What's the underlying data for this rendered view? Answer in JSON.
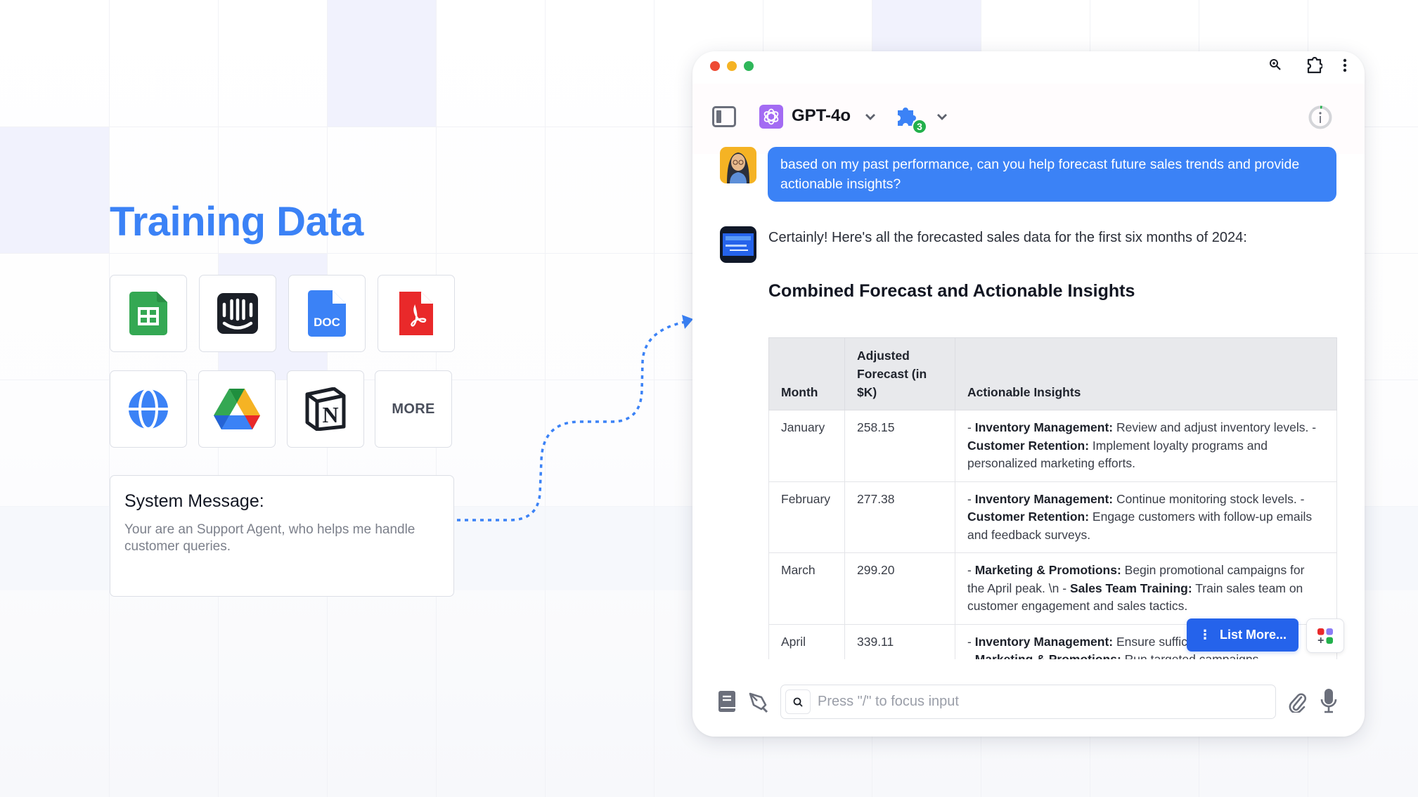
{
  "left": {
    "title": "Training Data",
    "sources": [
      {
        "name": "google-sheets",
        "label": "Google Sheets"
      },
      {
        "name": "intercom",
        "label": "Intercom"
      },
      {
        "name": "doc",
        "label": "DOC"
      },
      {
        "name": "pdf",
        "label": "PDF"
      },
      {
        "name": "website",
        "label": "Website"
      },
      {
        "name": "google-drive",
        "label": "Google Drive"
      },
      {
        "name": "notion",
        "label": "Notion"
      },
      {
        "name": "more",
        "label": "MORE"
      }
    ],
    "doc_badge": "DOC",
    "more_label": "MORE",
    "system_message": {
      "title": "System Message:",
      "text": "Your are an Support Agent, who helps me handle customer queries."
    }
  },
  "window": {
    "traffic_lights": {
      "close": "#ee4b34",
      "minimize": "#f5b324",
      "maximize": "#2fb75a"
    },
    "toolbar_icons": [
      "zoom-icon",
      "extension-icon",
      "more-vertical-icon"
    ],
    "header": {
      "model_name": "GPT-4o",
      "plugin_count": "3"
    },
    "messages": {
      "user": "based on my past performance, can you help forecast future sales trends and provide actionable insights?",
      "assistant_intro": "Certainly! Here's all the forecasted sales data for the first six months of 2024:",
      "heading": "Combined Forecast and Actionable Insights"
    },
    "table": {
      "headers": [
        "Month",
        "Adjusted Forecast (in $K)",
        "Actionable Insights"
      ],
      "rows": [
        {
          "month": "January",
          "forecast": "258.15",
          "insights": [
            {
              "b": "Inventory Management:",
              "t": " Review and adjust inventory levels. -"
            },
            {
              "b": "Customer Retention:",
              "t": " Implement loyalty programs and personalized marketing efforts."
            }
          ]
        },
        {
          "month": "February",
          "forecast": "277.38",
          "insights": [
            {
              "b": "Inventory Management:",
              "t": " Continue monitoring stock levels. -"
            },
            {
              "b": "Customer Retention:",
              "t": " Engage customers with follow-up emails and feedback surveys."
            }
          ]
        },
        {
          "month": "March",
          "forecast": "299.20",
          "insights": [
            {
              "b": "Marketing & Promotions:",
              "t": " Begin promotional campaigns for the April peak. \\n -"
            },
            {
              "b": "Sales Team Training:",
              "t": " Train sales team on customer engagement and sales tactics."
            }
          ]
        },
        {
          "month": "April",
          "forecast": "339.11",
          "insights": [
            {
              "b": "Inventory Management:",
              "t": " Ensure sufficient stock levels."
            },
            {
              "b": "Marketing & Promotions:",
              "t": " Run targeted campaigns."
            }
          ]
        }
      ]
    },
    "list_more_label": "List More...",
    "input": {
      "placeholder": "Press \"/\" to focus input",
      "value": ""
    }
  },
  "colors": {
    "accent": "#3b82f6",
    "list_more": "#2563eb",
    "model_logo": "#a36bf3",
    "badge_green": "#22b04b"
  }
}
